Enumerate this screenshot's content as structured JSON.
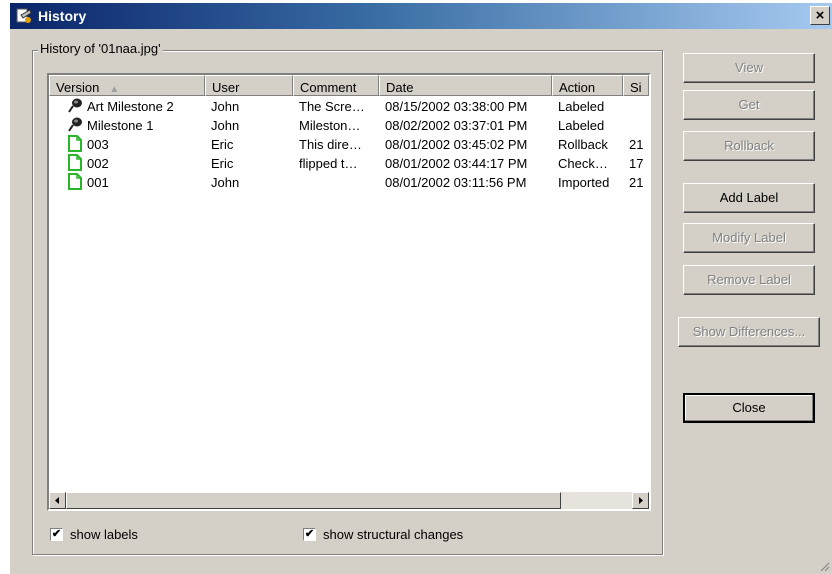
{
  "window": {
    "title": "History",
    "close_glyph": "×"
  },
  "history_group": {
    "legend": "History of '01naa.jpg'",
    "columns": [
      "Version",
      "User",
      "Comment",
      "Date",
      "Action",
      "Si"
    ],
    "sort_indicator": "▲",
    "rows": [
      {
        "icon": "label-pin-icon",
        "version": "Art Milestone 2",
        "user": "John",
        "comment": "The Scre…",
        "date": "08/15/2002 03:38:00 PM",
        "action": "Labeled",
        "size": ""
      },
      {
        "icon": "label-pin-icon",
        "version": "Milestone 1",
        "user": "John",
        "comment": "Mileston…",
        "date": "08/02/2002 03:37:01 PM",
        "action": "Labeled",
        "size": ""
      },
      {
        "icon": "file-icon",
        "version": "003",
        "user": "Eric",
        "comment": "This dire…",
        "date": "08/01/2002 03:45:02 PM",
        "action": "Rollback",
        "size": "21"
      },
      {
        "icon": "file-icon",
        "version": "002",
        "user": "Eric",
        "comment": "flipped t…",
        "date": "08/01/2002 03:44:17 PM",
        "action": "Check…",
        "size": "17"
      },
      {
        "icon": "file-icon",
        "version": "001",
        "user": "John",
        "comment": "",
        "date": "08/01/2002 03:11:56 PM",
        "action": "Imported",
        "size": "21"
      }
    ]
  },
  "options": {
    "show_labels": {
      "label": "show labels",
      "checked": true
    },
    "show_structural": {
      "label": "show structural changes",
      "checked": true
    },
    "check_glyph": "✔"
  },
  "buttons": {
    "view": "View",
    "get": "Get",
    "rollback": "Rollback",
    "add_label": "Add Label",
    "modify_label": "Modify Label",
    "remove_label": "Remove Label",
    "show_differences": "Show Differences...",
    "close": "Close"
  },
  "colors": {
    "title_gradient_start": "#0a246a",
    "title_gradient_end": "#a6caf0",
    "dialog_bg": "#d4d0c8",
    "file_icon_green": "#2bb52b"
  }
}
